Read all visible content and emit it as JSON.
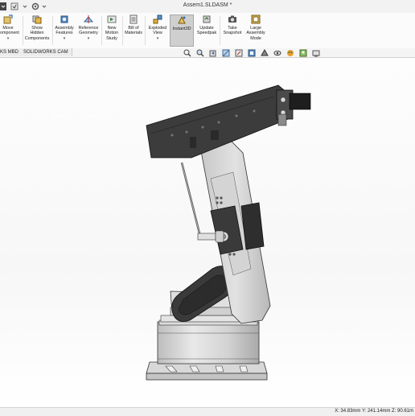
{
  "window": {
    "title": "Assem1.SLDASM *"
  },
  "ribbon": {
    "buttons": [
      {
        "label": "Move\nComponent",
        "icon": "move-component-icon",
        "has_dropdown": true
      },
      {
        "label": "Show\nHidden\nComponents",
        "icon": "show-hidden-components-icon",
        "has_dropdown": false
      },
      {
        "label": "Assembly\nFeatures",
        "icon": "assembly-features-icon",
        "has_dropdown": true
      },
      {
        "label": "Reference\nGeometry",
        "icon": "reference-geometry-icon",
        "has_dropdown": true
      },
      {
        "label": "New\nMotion\nStudy",
        "icon": "new-motion-study-icon",
        "has_dropdown": false
      },
      {
        "label": "Bill of\nMaterials",
        "icon": "bill-of-materials-icon",
        "has_dropdown": false
      },
      {
        "label": "Exploded\nView",
        "icon": "exploded-view-icon",
        "has_dropdown": true
      },
      {
        "label": "Instant3D",
        "icon": "instant3d-icon",
        "has_dropdown": false,
        "active": true
      },
      {
        "label": "Update\nSpeedpak",
        "icon": "update-speedpak-icon",
        "has_dropdown": false
      },
      {
        "label": "Take\nSnapshot",
        "icon": "take-snapshot-icon",
        "has_dropdown": false
      },
      {
        "label": "Large\nAssembly\nMode",
        "icon": "large-assembly-mode-icon",
        "has_dropdown": false
      }
    ]
  },
  "tabs": [
    {
      "label": "KS MBD"
    },
    {
      "label": "SOLIDWORKS CAM"
    }
  ],
  "statusbar": {
    "coords": "X: 34.83mm Y: 241.14mm Z: 90.61m"
  },
  "colors": {
    "accent_active": "#cfcfcf",
    "part_dark": "#3a3a3a",
    "part_light": "#d6d6d6"
  }
}
